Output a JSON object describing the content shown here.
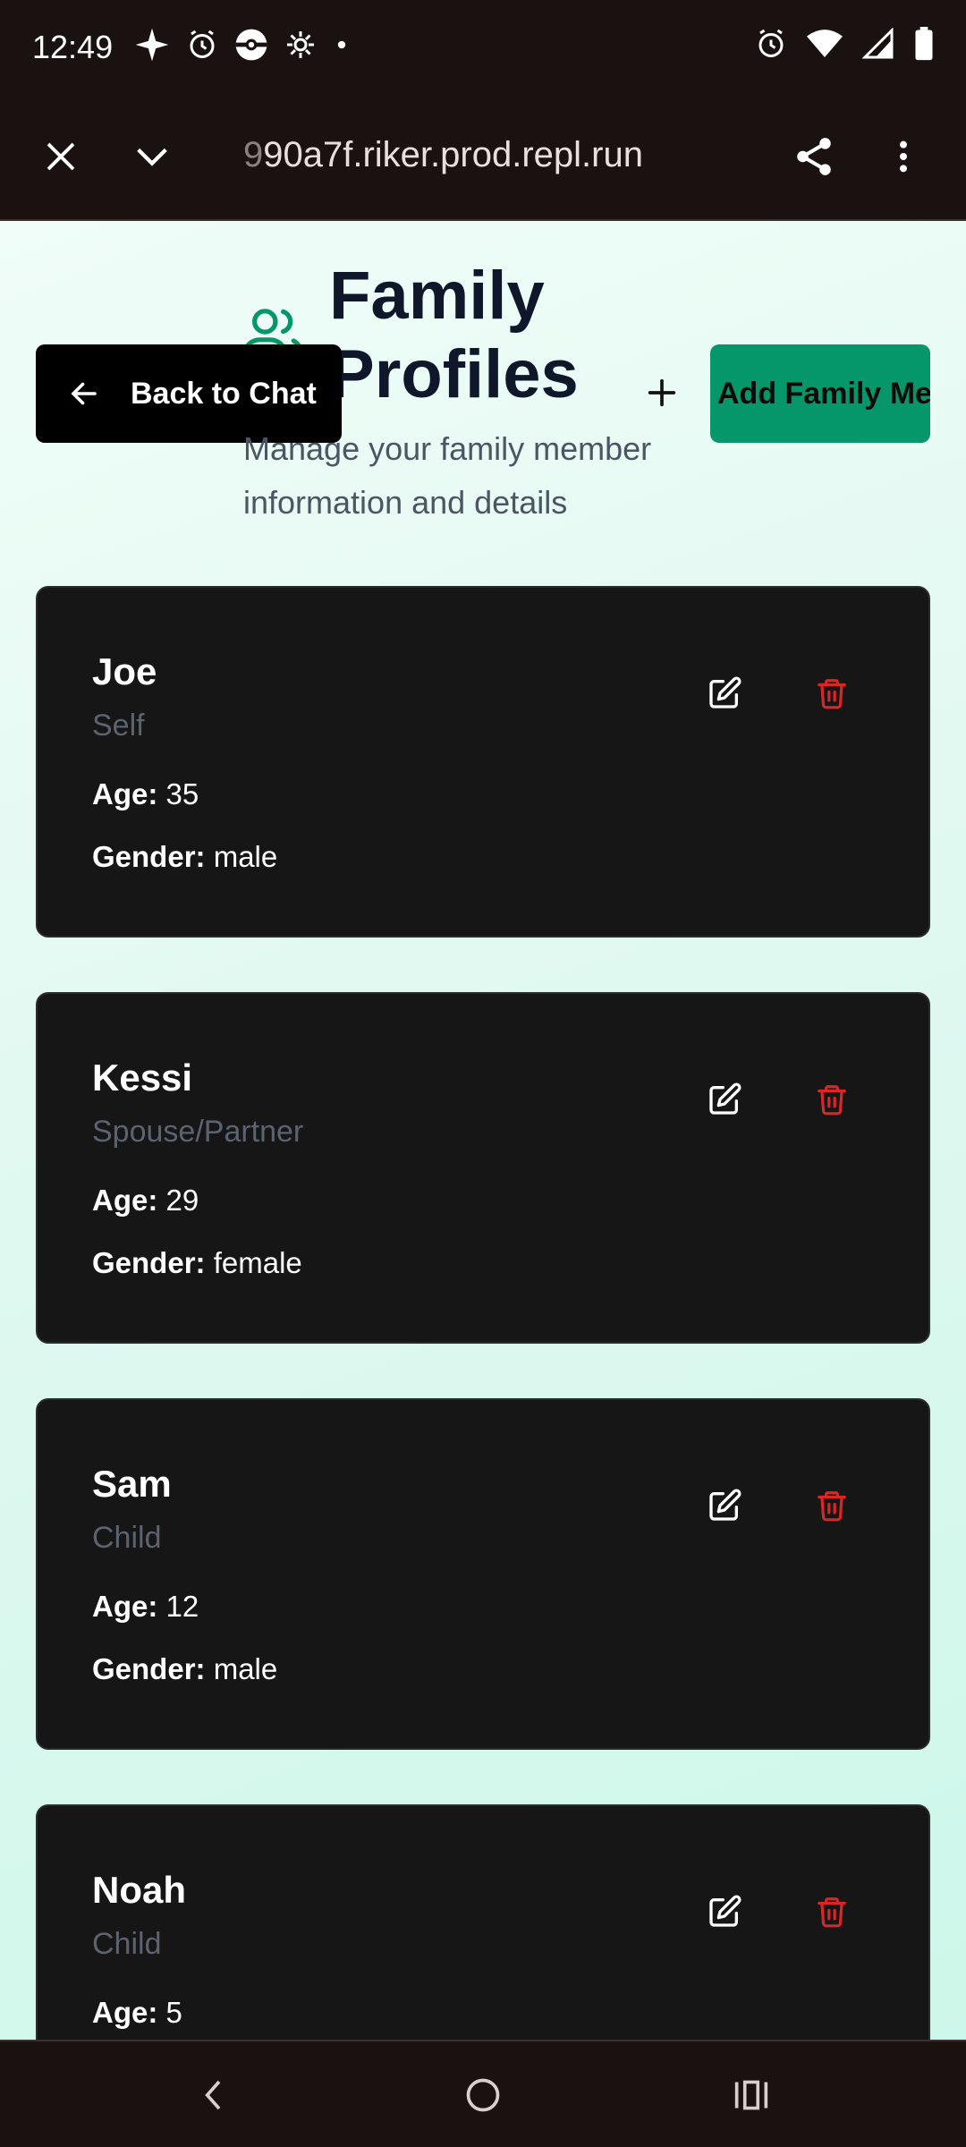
{
  "status_bar": {
    "time": "12:49",
    "left_icons": [
      "sparkle-icon",
      "alarm-icon",
      "pokeball-icon",
      "gear-sun-icon",
      "dot-icon"
    ],
    "right_icons": [
      "alarm-icon",
      "wifi-icon",
      "signal-icon",
      "battery-icon"
    ]
  },
  "browser": {
    "url_faded": "9",
    "url": "90a7f.riker.prod.repl.run"
  },
  "header": {
    "back_label": "Back to Chat",
    "title": "Family Profiles",
    "subtitle": "Manage your family member information and details",
    "add_label": "Add Family Member"
  },
  "labels": {
    "age": "Age:",
    "gender": "Gender:"
  },
  "members": [
    {
      "name": "Joe",
      "relation": "Self",
      "age": "35",
      "gender": "male"
    },
    {
      "name": "Kessi",
      "relation": "Spouse/Partner",
      "age": "29",
      "gender": "female"
    },
    {
      "name": "Sam",
      "relation": "Child",
      "age": "12",
      "gender": "male"
    },
    {
      "name": "Noah",
      "relation": "Child",
      "age": "5",
      "gender": ""
    }
  ],
  "colors": {
    "accent": "#059669",
    "delete": "#dc2626",
    "card_bg": "#161616",
    "title": "#0f172a"
  }
}
